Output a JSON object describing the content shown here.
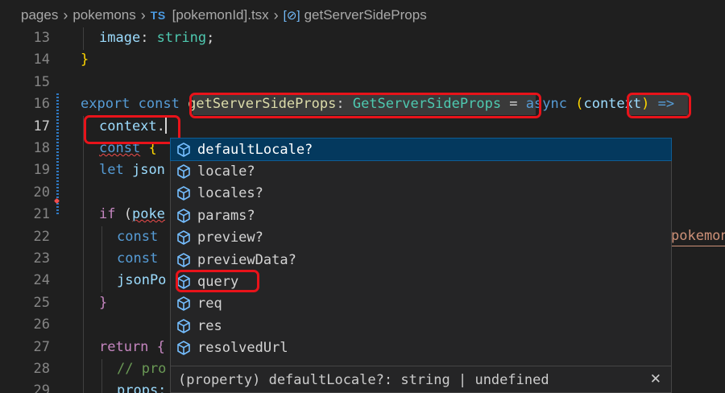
{
  "breadcrumb": {
    "items": [
      "pages",
      "pokemons",
      "[pokemonId].tsx",
      "getServerSideProps"
    ],
    "file_badge": "TS"
  },
  "editor": {
    "line_numbers": [
      "13",
      "14",
      "15",
      "16",
      "17",
      "18",
      "19",
      "20",
      "21",
      "22",
      "23",
      "24",
      "25",
      "26",
      "27",
      "28",
      "29"
    ],
    "active_line": "17",
    "lines": {
      "l13": [
        "image",
        ": ",
        "string",
        ";"
      ],
      "l14": [
        "}"
      ],
      "l16": [
        "export",
        " ",
        "const",
        " ",
        "getServerSideProps",
        ": ",
        "GetServerSideProps",
        " = ",
        "async",
        " ",
        "(",
        "context",
        ") ",
        "=>"
      ],
      "l17": [
        "context",
        "."
      ],
      "l18": [
        "const",
        " ",
        "{"
      ],
      "l19": [
        "let",
        " ",
        "json"
      ],
      "l21": [
        "if",
        " (",
        "poke"
      ],
      "l22": [
        "const"
      ],
      "l22_right": "pokemon",
      "l23": [
        "const"
      ],
      "l24": [
        "jsonPo"
      ],
      "l25": [
        "}"
      ],
      "l27": [
        "return",
        " ",
        "{"
      ],
      "l28": [
        "// pro"
      ],
      "l29": [
        "props:"
      ]
    }
  },
  "suggest": {
    "items": [
      {
        "label": "defaultLocale?",
        "icon": "property-icon"
      },
      {
        "label": "locale?",
        "icon": "property-icon"
      },
      {
        "label": "locales?",
        "icon": "property-icon"
      },
      {
        "label": "params?",
        "icon": "property-icon"
      },
      {
        "label": "preview?",
        "icon": "property-icon"
      },
      {
        "label": "previewData?",
        "icon": "property-icon"
      },
      {
        "label": "query",
        "icon": "property-icon"
      },
      {
        "label": "req",
        "icon": "property-icon"
      },
      {
        "label": "res",
        "icon": "property-icon"
      },
      {
        "label": "resolvedUrl",
        "icon": "property-icon"
      }
    ],
    "selected_index": 0,
    "detail": "(property) defaultLocale?: string | undefined",
    "close_glyph": "✕"
  },
  "colors": {
    "annotation_box": "#e8131a",
    "selection": "#04395e",
    "background": "#1f1f1f"
  }
}
